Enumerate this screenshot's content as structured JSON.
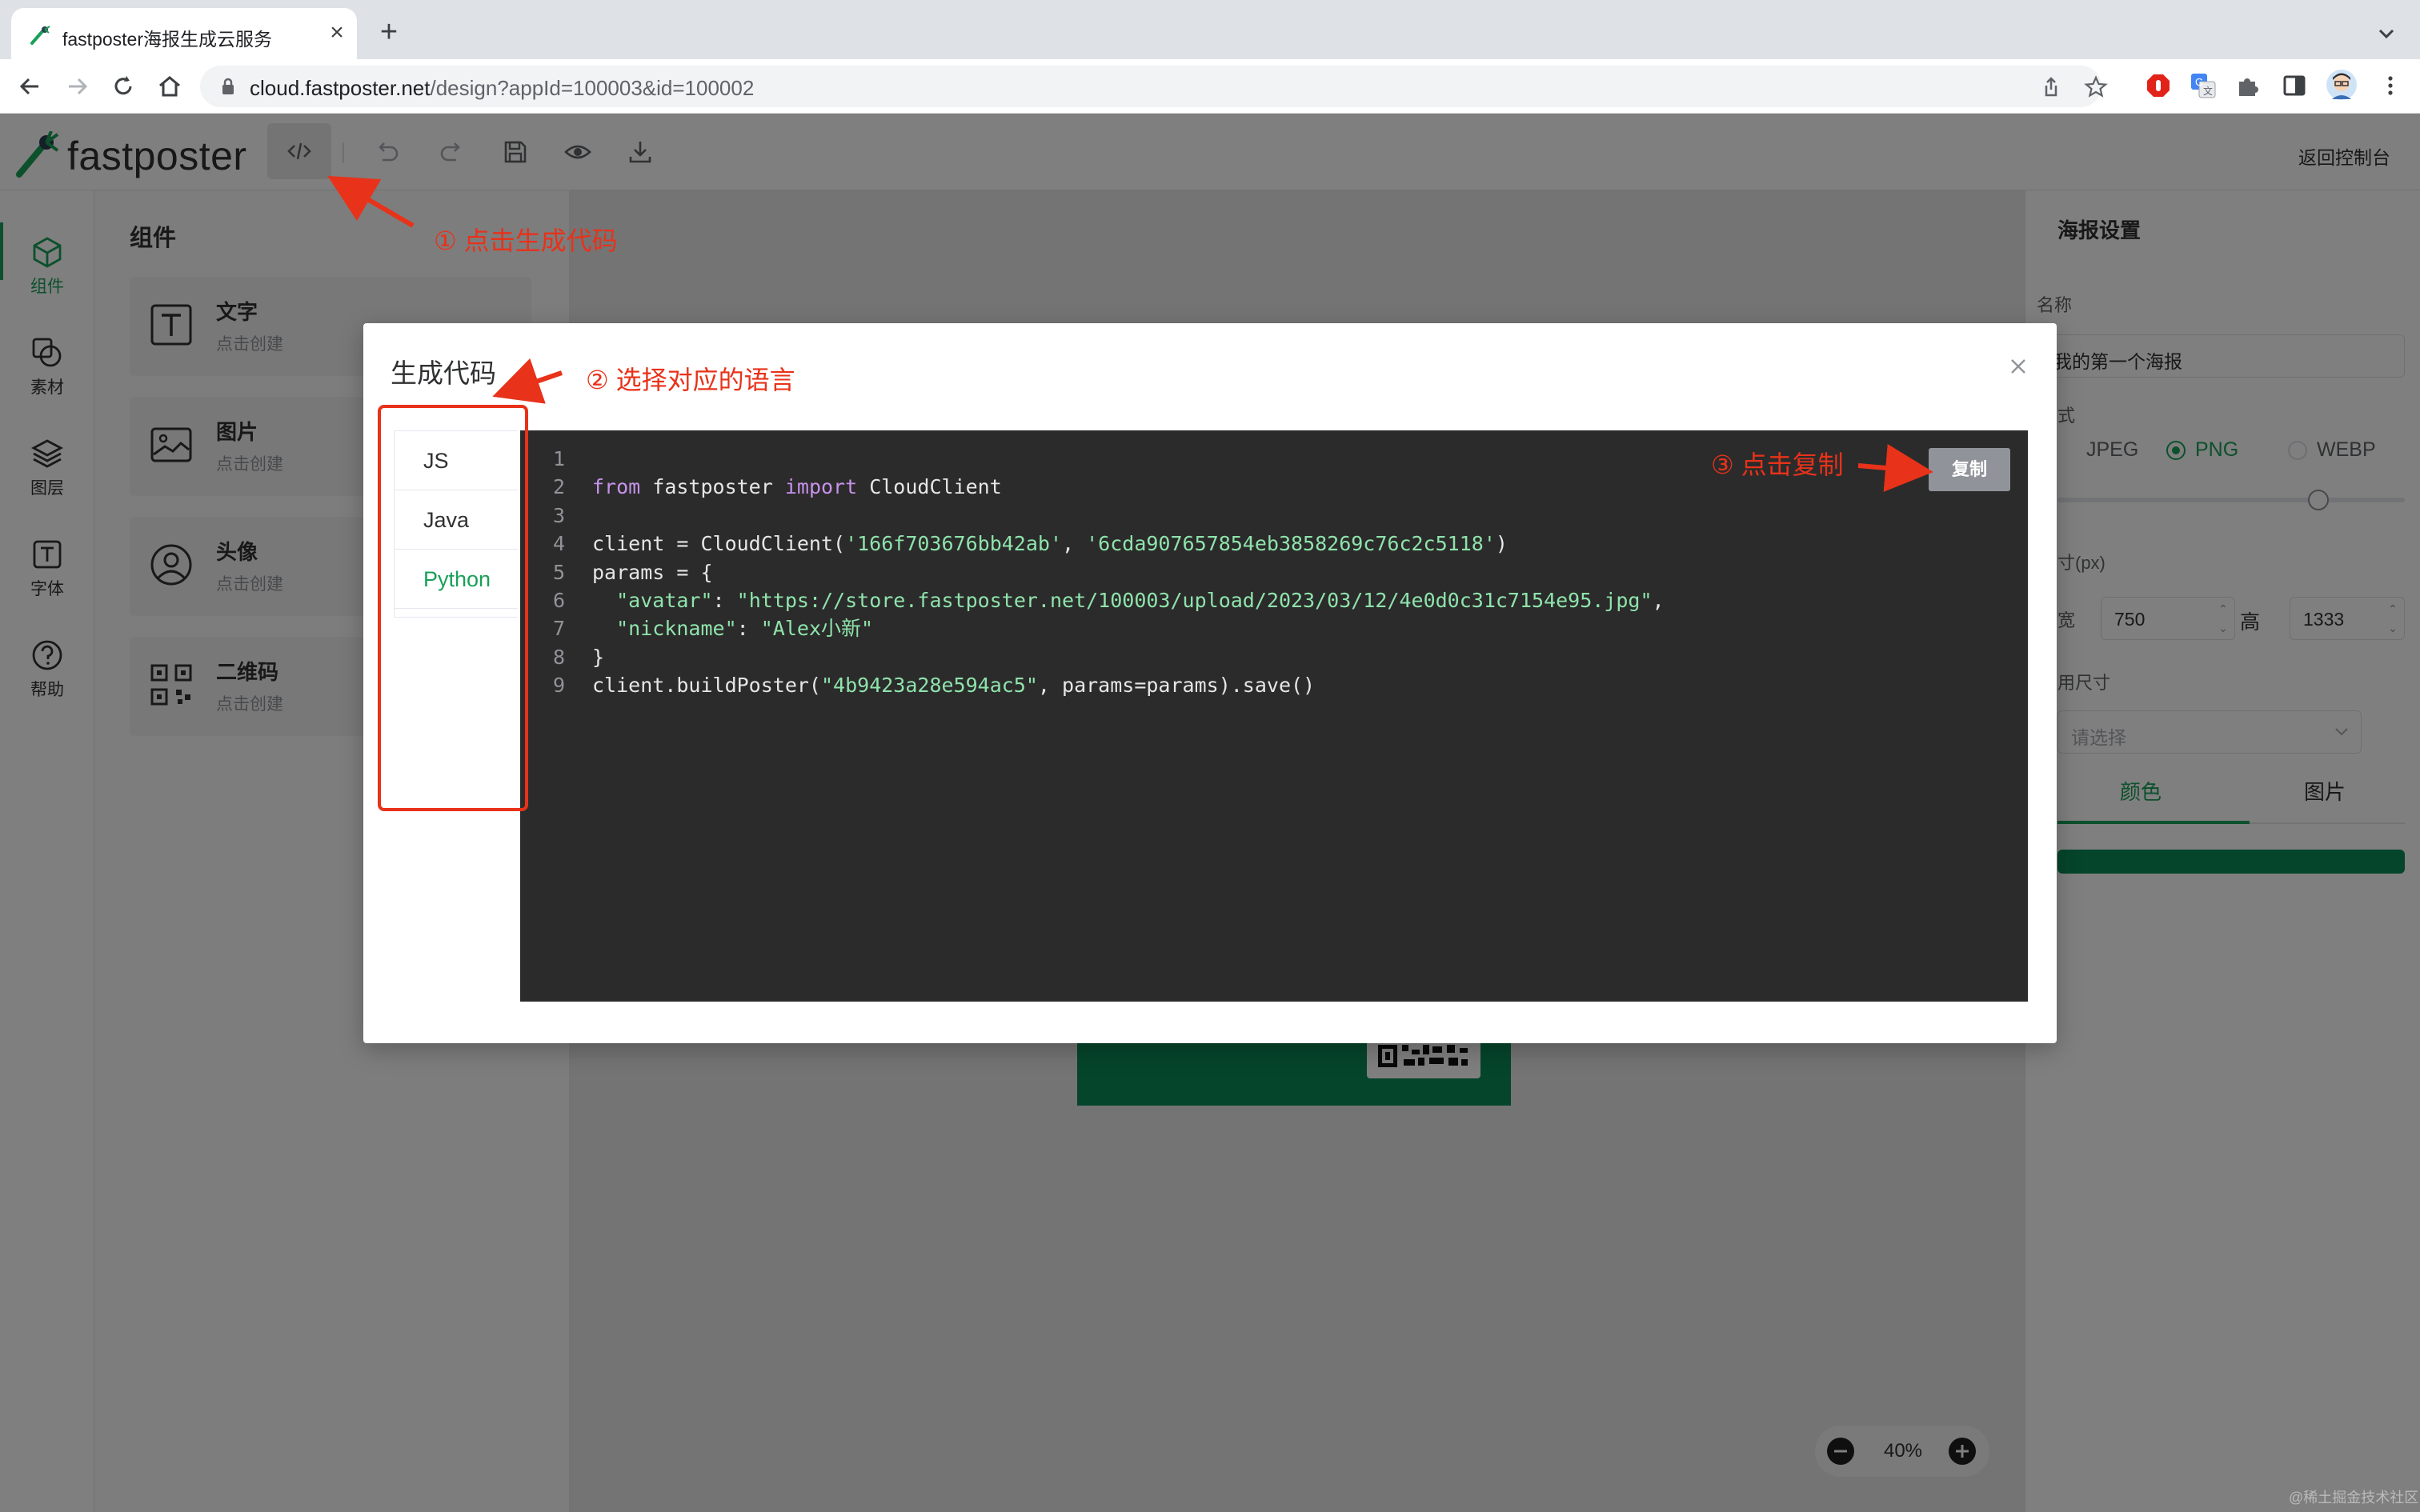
{
  "browser": {
    "tab_title": "fastposter海报生成云服务",
    "url_host": "cloud.fastposter.net",
    "url_path": "/design?appId=100003&id=100002"
  },
  "app": {
    "logo_text": "fastposter",
    "back_console": "返回控制台"
  },
  "rail": {
    "items": [
      {
        "label": "组件",
        "icon": "cube-icon"
      },
      {
        "label": "素材",
        "icon": "shapes-icon"
      },
      {
        "label": "图层",
        "icon": "layers-icon"
      },
      {
        "label": "字体",
        "icon": "font-icon"
      },
      {
        "label": "帮助",
        "icon": "help-icon"
      }
    ]
  },
  "components": {
    "title": "组件",
    "cards": [
      {
        "name": "文字",
        "sub": "点击创建",
        "icon": "text-icon"
      },
      {
        "name": "图片",
        "sub": "点击创建",
        "icon": "image-icon"
      },
      {
        "name": "头像",
        "sub": "点击创建",
        "icon": "avatar-icon"
      },
      {
        "name": "二维码",
        "sub": "点击创建",
        "icon": "qrcode-icon"
      }
    ]
  },
  "settings": {
    "title": "海报设置",
    "name_label": "名称",
    "name_value": "我的第一个海报",
    "format_label": "式",
    "formats": [
      {
        "label": "JPEG",
        "checked": false
      },
      {
        "label": "PNG",
        "checked": true
      },
      {
        "label": "WEBP",
        "checked": false
      }
    ],
    "quality_fraction": 0.75,
    "size_label": "寸(px)",
    "width_label": "宽",
    "width_value": "750",
    "height_label": "高",
    "height_value": "1333",
    "preset_label": "用尺寸",
    "preset_placeholder": "请选择",
    "bg_tabs": [
      "颜色",
      "图片"
    ],
    "bg_color": "#0b8a59"
  },
  "zoom": {
    "value": "40%"
  },
  "modal": {
    "title": "生成代码",
    "languages": [
      {
        "label": "JS",
        "active": false
      },
      {
        "label": "Java",
        "active": false
      },
      {
        "label": "Python",
        "active": true
      }
    ],
    "copy_label": "复制",
    "line_numbers": [
      "1",
      "2",
      "3",
      "4",
      "5",
      "6",
      "7",
      "8",
      "9"
    ],
    "code_lines": [
      "",
      "from fastposter import CloudClient",
      "",
      "client = CloudClient('166f703676bb42ab', '6cda907657854eb3858269c76c2c5118')",
      "params = {",
      "  \"avatar\": \"https://store.fastposter.net/100003/upload/2023/03/12/4e0d0c31c7154e95.jpg\",",
      "  \"nickname\": \"Alex小新\"",
      "}",
      "client.buildPoster(\"4b9423a28e594ac5\", params=params).save()"
    ]
  },
  "annotations": {
    "step1": "① 点击生成代码",
    "step2": "② 选择对应的语言",
    "step3": "③ 点击复制"
  },
  "watermark": "@稀土掘金技术社区",
  "colors": {
    "accent": "#18a058",
    "annotation": "#e8321a",
    "code_bg": "#2b2b2b"
  }
}
